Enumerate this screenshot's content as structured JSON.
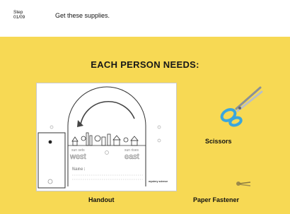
{
  "header": {
    "step_line1": "Step",
    "step_line2": "01/09",
    "title": "Get these supplies."
  },
  "section": {
    "title": "EACH PERSON NEEDS:"
  },
  "items": [
    {
      "label": "Handout",
      "icon": "handout-sheet"
    },
    {
      "label": "Scissors",
      "icon": "scissors-icon"
    },
    {
      "label": "Paper Fastener",
      "icon": "paper-fastener-icon"
    }
  ],
  "handout": {
    "label_sun_sets": "sun sets",
    "label_west": "west",
    "label_sun_rises": "sun rises",
    "label_east": "east",
    "name_label": "Name:",
    "brand": "mystery science"
  },
  "colors": {
    "panel": "#f7d954",
    "scissors_handle": "#3aa6dd"
  }
}
